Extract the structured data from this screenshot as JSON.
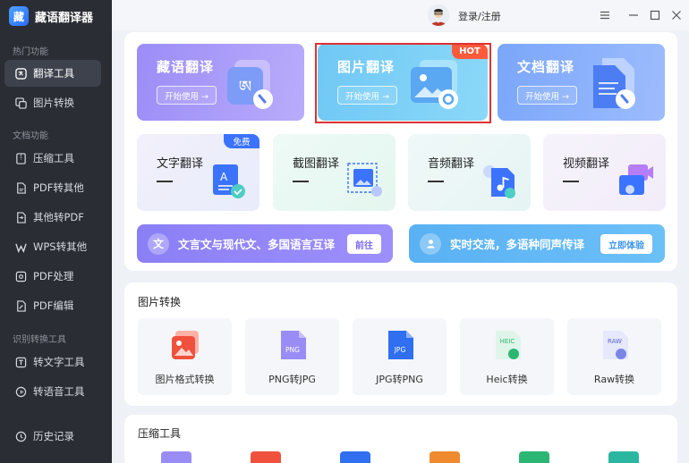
{
  "app": {
    "name": "藏语翻译器",
    "logo_text": "藏"
  },
  "topbar": {
    "login": "登录/注册"
  },
  "sidebar": {
    "sections": [
      {
        "title": "热门功能",
        "items": [
          {
            "label": "翻译工具",
            "icon": "translate-icon",
            "active": true
          },
          {
            "label": "图片转换",
            "icon": "image-convert-icon"
          }
        ]
      },
      {
        "title": "文档功能",
        "items": [
          {
            "label": "压缩工具",
            "icon": "compress-icon"
          },
          {
            "label": "PDF转其他",
            "icon": "pdf-icon"
          },
          {
            "label": "其他转PDF",
            "icon": "file-to-pdf-icon"
          },
          {
            "label": "WPS转其他",
            "icon": "wps-icon"
          },
          {
            "label": "PDF处理",
            "icon": "pdf-process-icon"
          },
          {
            "label": "PDF编辑",
            "icon": "pdf-edit-icon"
          }
        ]
      },
      {
        "title": "识别转换工具",
        "items": [
          {
            "label": "转文字工具",
            "icon": "text-convert-icon"
          },
          {
            "label": "转语音工具",
            "icon": "voice-convert-icon"
          }
        ]
      }
    ],
    "history": "历史记录"
  },
  "big_cards": [
    {
      "title": "藏语翻译",
      "button": "开始使用 →"
    },
    {
      "title": "图片翻译",
      "button": "开始使用 →",
      "badge": "HOT"
    },
    {
      "title": "文档翻译",
      "button": "开始使用 →"
    }
  ],
  "small_cards": [
    {
      "title": "文字翻译",
      "badge": "免费"
    },
    {
      "title": "截图翻译"
    },
    {
      "title": "音频翻译"
    },
    {
      "title": "视频翻译"
    }
  ],
  "banners": [
    {
      "icon_text": "文",
      "text": "文言文与现代文、多国语言互译",
      "button": "前往"
    },
    {
      "text": "实时交流，多语种同声传译",
      "button": "立即体验"
    }
  ],
  "image_section": {
    "title": "图片转换",
    "tools": [
      {
        "label": "图片格式转换"
      },
      {
        "label": "PNG转JPG",
        "icon_text": "PNG"
      },
      {
        "label": "JPG转PNG",
        "icon_text": "JPG"
      },
      {
        "label": "Heic转换",
        "icon_text": "HEIC"
      },
      {
        "label": "Raw转换",
        "icon_text": "RAW"
      }
    ]
  },
  "compress_section": {
    "title": "压缩工具"
  },
  "colors": {
    "sidebar_bg": "#2a2d34",
    "accent": "#3b73ff",
    "hot": "#ff5a3c",
    "outline": "#e03131"
  }
}
